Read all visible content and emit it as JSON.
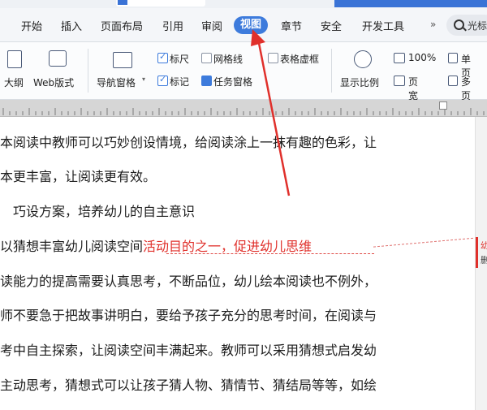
{
  "colors": {
    "accent": "#3d7bdc",
    "annotation_red": "#e0302b"
  },
  "menu": {
    "items": [
      "开始",
      "插入",
      "页面布局",
      "引用",
      "审阅",
      "视图",
      "章节",
      "安全",
      "开发工具"
    ],
    "active": "视图",
    "more_icon": "chevron-double-right",
    "search_label": "光标"
  },
  "ribbon": {
    "outline": "大纲",
    "web_layout": "Web版式",
    "nav_pane": "导航窗格",
    "ruler": "标尺",
    "gridlines": "网格线",
    "table_gridlines": "表格虚框",
    "marks": "标记",
    "task_pane": "任务窗格",
    "zoom_display": "显示比例",
    "zoom_100": "100%",
    "page_width": "页宽",
    "one_page": "单页",
    "multi_page": "多页"
  },
  "checkboxes": {
    "ruler": true,
    "gridlines": false,
    "table_gridlines": false,
    "marks": true,
    "task_pane": true
  },
  "document": {
    "lines": [
      "本阅读中教师可以巧妙创设情境，给阅读涂上一抹有趣的色彩，让",
      "本更丰富，让阅读更有效。",
      "　巧设方案，培养幼儿的自主意识",
      "以猜想丰富幼儿阅读空间",
      "读能力的提高需要认真思考，不断品位，幼儿绘本阅读也不例外，",
      "师不要急于把故事讲明白，要给予孩子充分的思考时间，在阅读与",
      "考中自主探索，让阅读空间丰满起来。教师可以采用猜想式启发幼",
      "主动思考，猜想式可以让孩子猜人物、猜情节、猜结局等等，如绘"
    ],
    "comment_text": "活动目的之一，促进幼儿思维"
  },
  "comment_pane": {
    "line1": "幼",
    "line2": "删"
  }
}
